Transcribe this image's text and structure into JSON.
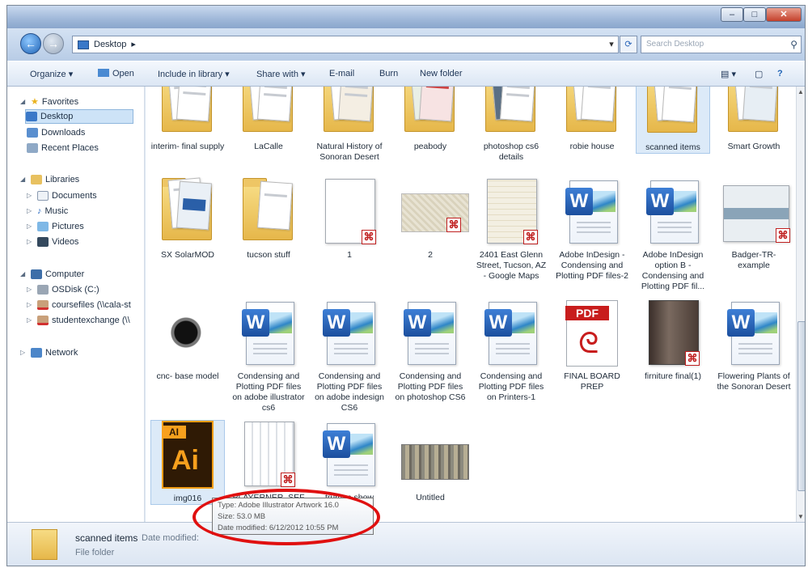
{
  "window": {
    "controls": [
      "–",
      "□",
      "✕"
    ]
  },
  "nav": {
    "address": "Desktop",
    "breadcrumb_sep": "▸",
    "search_placeholder": "Search Desktop"
  },
  "toolbar": {
    "organize": "Organize ▾",
    "open": "Open",
    "include": "Include in library ▾",
    "share": "Share with ▾",
    "email": "E-mail",
    "burn": "Burn",
    "new_folder": "New folder",
    "help": "?"
  },
  "sidebar": {
    "favorites": "Favorites",
    "desktop": "Desktop",
    "downloads": "Downloads",
    "recent": "Recent Places",
    "libraries": "Libraries",
    "documents": "Documents",
    "music": "Music",
    "pictures": "Pictures",
    "videos": "Videos",
    "computer": "Computer",
    "osdisk": "OSDisk (C:)",
    "coursefiles": "coursefiles (\\\\cala-st",
    "studentexchange": "studentexchange (\\\\",
    "network": "Network"
  },
  "files": {
    "r1": [
      "interim- final supply",
      "LaCalle",
      "Natural History of Sonoran Desert",
      "peabody",
      "photoshop cs6 details",
      "robie house",
      "scanned items",
      "Smart Growth"
    ],
    "r2": [
      "SX SolarMOD",
      "tucson stuff",
      "1",
      "2",
      "2401 East Glenn Street, Tucson, AZ - Google Maps",
      "Adobe InDesign -Condensing and Plotting PDF files-2",
      "Adobe InDesign option B -Condensing and Plotting PDF fil...",
      "Badger-TR-example"
    ],
    "r3": [
      "cnc- base model",
      "Condensing and Plotting PDF files on adobe illustrator cs6",
      "Condensing and Plotting PDF files on adobe indesign CS6",
      "Condensing and Plotting PDF files on photoshop CS6",
      "Condensing and Plotting PDF files on Printers-1",
      "FINAL BOARD PREP",
      "firniture final(1)",
      "Flowering Plants of the Sonoran Desert"
    ],
    "r4": [
      "img016",
      "PLAYERNER_SEF",
      "truman show",
      "Untitled"
    ]
  },
  "icons": {
    "pdf_band": "PDF",
    "ai_tab": "AI",
    "ai_logo": "Ai",
    "word_letter": "W"
  },
  "tooltip": {
    "type": "Type: Adobe Illustrator Artwork 16.0",
    "size": "Size: 53.0 MB",
    "modified": "Date modified: 6/12/2012 10:55 PM"
  },
  "status": {
    "name": "scanned items",
    "modified_label": "Date modified:",
    "type": "File folder"
  },
  "colors": {
    "accent": "#1f63b5",
    "annotation": "#e01010"
  }
}
